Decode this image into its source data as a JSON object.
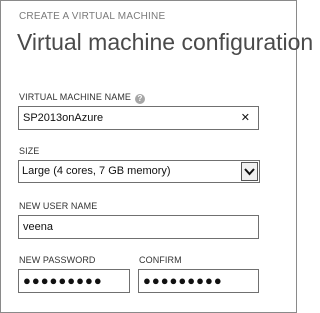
{
  "wizard": {
    "step_label": "CREATE A VIRTUAL MACHINE",
    "title": "Virtual machine configuration"
  },
  "vm_name": {
    "label": "VIRTUAL MACHINE NAME",
    "help_icon": "?",
    "value": "SP2013onAzure",
    "clear_icon": "✕"
  },
  "size": {
    "label": "SIZE",
    "selected": "Large (4 cores, 7 GB memory)",
    "arrow_icon": "chevron-down-icon"
  },
  "new_user": {
    "label": "NEW USER NAME",
    "value": "veena"
  },
  "password": {
    "label": "NEW PASSWORD",
    "value": "●●●●●●●●●"
  },
  "confirm": {
    "label": "CONFIRM",
    "value": "●●●●●●●●●"
  }
}
